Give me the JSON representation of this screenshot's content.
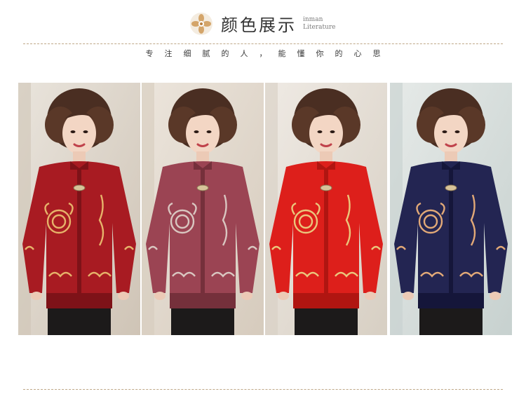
{
  "header": {
    "title": "颜色展示",
    "subtitle_en_line1": "inman",
    "subtitle_en_line2": "Literature"
  },
  "slogan": "专注细腻的人，能懂你的心思",
  "panels": [
    {
      "color_name": "wine-red",
      "cardigan": "#a81b22",
      "cardigan_dark": "#7e1218",
      "embroidery": "#e6b36a"
    },
    {
      "color_name": "rose-mauve",
      "cardigan": "#9b4453",
      "cardigan_dark": "#75303b",
      "embroidery": "#d9c6c0"
    },
    {
      "color_name": "bright-red",
      "cardigan": "#dd1f1b",
      "cardigan_dark": "#b01511",
      "embroidery": "#eac67c"
    },
    {
      "color_name": "navy",
      "cardigan": "#232552",
      "cardigan_dark": "#15163a",
      "embroidery": "#e2a977"
    }
  ],
  "colors": {
    "rule": "#bfa888",
    "text": "#333333"
  }
}
